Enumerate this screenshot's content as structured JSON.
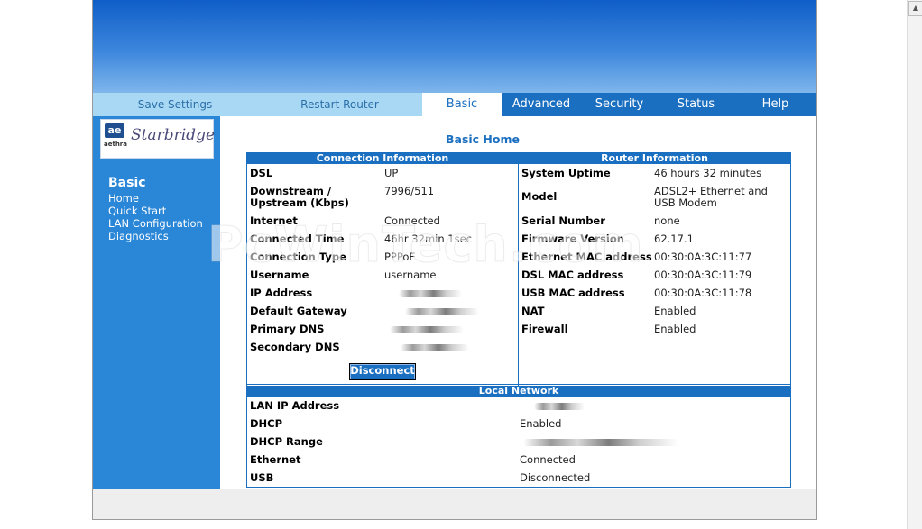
{
  "toolbar": {
    "save_settings": "Save Settings",
    "restart_router": "Restart Router"
  },
  "tabs": [
    "Basic",
    "Advanced",
    "Security",
    "Status",
    "Help"
  ],
  "active_tab": "Basic",
  "logo": {
    "mark": "ae",
    "sub": "aethra",
    "name": "Starbridge"
  },
  "sidebar": {
    "heading": "Basic",
    "links": [
      "Home",
      "Quick Start",
      "LAN Configuration",
      "Diagnostics"
    ]
  },
  "page_title": "Basic Home",
  "connection": {
    "header": "Connection Information",
    "rows": [
      {
        "label": "DSL",
        "value": "UP"
      },
      {
        "label": "Downstream / Upstream (Kbps)",
        "value": "7996/511"
      },
      {
        "label": "Internet",
        "value": "Connected"
      },
      {
        "label": "Connected Time",
        "value": "46hr 32min 1sec"
      },
      {
        "label": "Connection Type",
        "value": "PPPoE"
      },
      {
        "label": "Username",
        "value": "username"
      },
      {
        "label": "IP Address",
        "value": ""
      },
      {
        "label": "Default Gateway",
        "value": ""
      },
      {
        "label": "Primary DNS",
        "value": ""
      },
      {
        "label": "Secondary DNS",
        "value": ""
      }
    ],
    "button": "Disconnect"
  },
  "router": {
    "header": "Router Information",
    "rows": [
      {
        "label": "System Uptime",
        "value": "46 hours 32 minutes"
      },
      {
        "label": "Model",
        "value": "ADSL2+ Ethernet and USB Modem"
      },
      {
        "label": "Serial Number",
        "value": "none"
      },
      {
        "label": "Firmware Version",
        "value": "62.17.1"
      },
      {
        "label": "Ethernet MAC address",
        "value": "00:30:0A:3C:11:77"
      },
      {
        "label": "DSL MAC address",
        "value": "00:30:0A:3C:11:79"
      },
      {
        "label": "USB MAC address",
        "value": "00:30:0A:3C:11:78"
      },
      {
        "label": "NAT",
        "value": "Enabled"
      },
      {
        "label": "Firewall",
        "value": "Enabled"
      }
    ]
  },
  "local_network": {
    "header": "Local Network",
    "rows": [
      {
        "label": "LAN IP Address",
        "value": ""
      },
      {
        "label": "DHCP",
        "value": "Enabled"
      },
      {
        "label": "DHCP Range",
        "value": ""
      },
      {
        "label": "Ethernet",
        "value": "Connected"
      },
      {
        "label": "USB",
        "value": "Disconnected"
      }
    ]
  },
  "watermark": "PcWinTech.com",
  "colors": {
    "accent": "#1b6fc0",
    "sidebar": "#2a86d6",
    "toolbar": "#a9d8f5"
  }
}
